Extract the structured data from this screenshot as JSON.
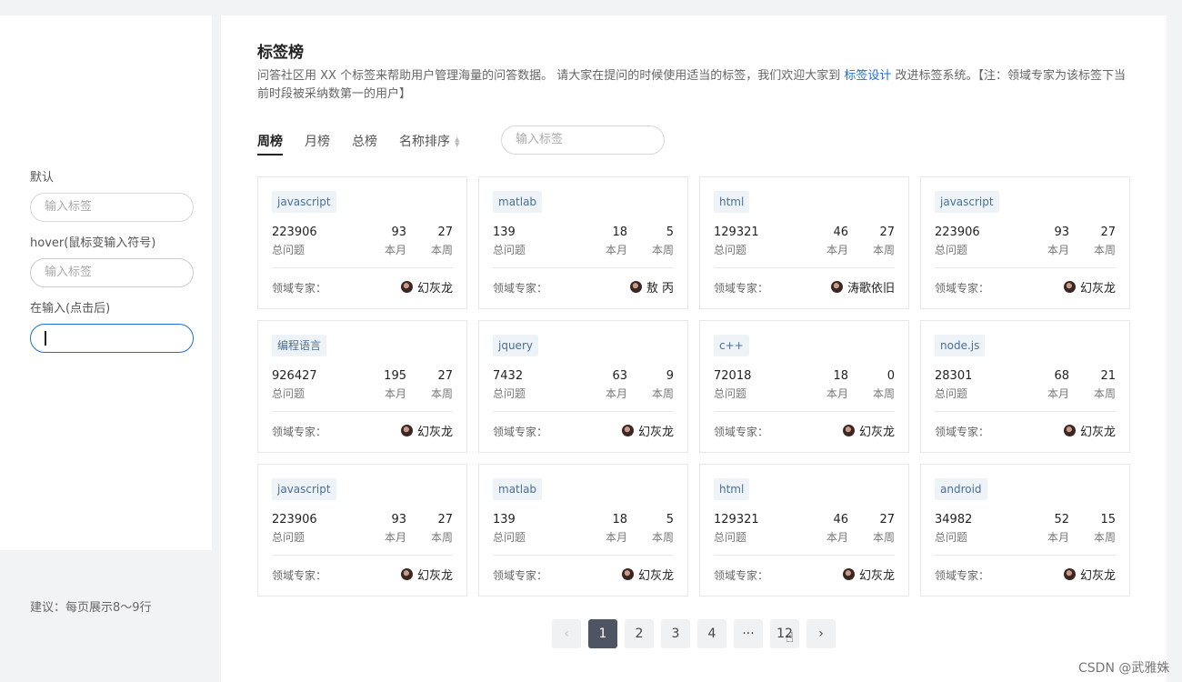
{
  "sidebar": {
    "label_default": "默认",
    "label_hover": "hover(鼠标变输入符号)",
    "label_active": "在输入(点击后)",
    "input_placeholder": "输入标签",
    "suggestion": "建议：每页展示8～9行"
  },
  "header": {
    "title": "标签榜",
    "desc_before": "问答社区用 XX 个标签来帮助用户管理海量的问答数据。 请大家在提问的时候使用适当的标签，我们欢迎大家到 ",
    "desc_link": "标签设计",
    "desc_after": " 改进标签系统。【注：领域专家为该标签下当前时段被采纳数第一的用户】"
  },
  "tabs": [
    "周榜",
    "月榜",
    "总榜",
    "名称排序"
  ],
  "search": {
    "placeholder": "输入标签"
  },
  "card_labels": {
    "total": "总问题",
    "month": "本月",
    "week": "本周",
    "expert": "领域专家："
  },
  "cards": [
    {
      "tag": "javascript",
      "total": "223906",
      "month": "93",
      "week": "27",
      "expert": "幻灰龙"
    },
    {
      "tag": "matlab",
      "total": "139",
      "month": "18",
      "week": "5",
      "expert": "敖 丙"
    },
    {
      "tag": "html",
      "total": "129321",
      "month": "46",
      "week": "27",
      "expert": "涛歌依旧"
    },
    {
      "tag": "javascript",
      "total": "223906",
      "month": "93",
      "week": "27",
      "expert": "幻灰龙"
    },
    {
      "tag": "编程语言",
      "total": "926427",
      "month": "195",
      "week": "27",
      "expert": "幻灰龙"
    },
    {
      "tag": "jquery",
      "total": "7432",
      "month": "63",
      "week": "9",
      "expert": "幻灰龙"
    },
    {
      "tag": "c++",
      "total": "72018",
      "month": "18",
      "week": "0",
      "expert": "幻灰龙"
    },
    {
      "tag": "node.js",
      "total": "28301",
      "month": "68",
      "week": "21",
      "expert": "幻灰龙"
    },
    {
      "tag": "javascript",
      "total": "223906",
      "month": "93",
      "week": "27",
      "expert": "幻灰龙"
    },
    {
      "tag": "matlab",
      "total": "139",
      "month": "18",
      "week": "5",
      "expert": "幻灰龙"
    },
    {
      "tag": "html",
      "total": "129321",
      "month": "46",
      "week": "27",
      "expert": "幻灰龙"
    },
    {
      "tag": "android",
      "total": "34982",
      "month": "52",
      "week": "15",
      "expert": "幻灰龙"
    }
  ],
  "pagination": {
    "prev": "‹",
    "pages": [
      "1",
      "2",
      "3",
      "4",
      "···",
      "12"
    ],
    "next": "›",
    "current": "1"
  },
  "watermark": "CSDN @武雅姝"
}
